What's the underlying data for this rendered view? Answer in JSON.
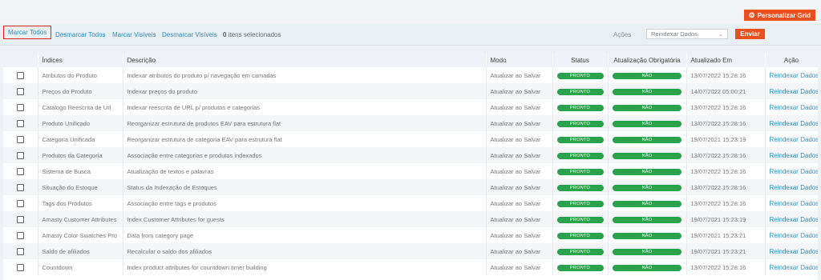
{
  "header": {
    "customize_grid_label": "Personalizar Grid"
  },
  "massaction": {
    "select_all": "Marcar Todos",
    "unselect_all": "Desmarcar Todos",
    "select_visible": "Marcar Visíveis",
    "unselect_visible": "Desmarcar Visíveis",
    "selected_count": "0",
    "selected_suffix": "itens selecionados",
    "actions_label": "Ações",
    "actions_value": "Reindexar Dados",
    "submit_label": "Enviar"
  },
  "table": {
    "columns": [
      "Índices",
      "Descrição",
      "Modo",
      "Status",
      "Atualização Obrigatória",
      "Atualizado Em",
      "Ação"
    ],
    "rows": [
      {
        "index": "Atributos do Produto",
        "description": "Indexar atributos do produto p/ navegação em camadas",
        "mode": "Atualizar ao Salvar",
        "status": "PRONTO",
        "required": "NÃO",
        "updated": "13/07/2022 15:28:16",
        "action": "Reindexar Dados"
      },
      {
        "index": "Preços do Produto",
        "description": "Indexar preços do produto",
        "mode": "Atualizar ao Salvar",
        "status": "PRONTO",
        "required": "NÃO",
        "updated": "14/07/2022 05:00:21",
        "action": "Reindexar Dados"
      },
      {
        "index": "Catálogo Reescrita de Url",
        "description": "Indexar reescrita de URL p/ produtos e categorias",
        "mode": "Atualizar ao Salvar",
        "status": "PRONTO",
        "required": "NÃO",
        "updated": "13/07/2022 15:28:16",
        "action": "Reindexar Dados"
      },
      {
        "index": "Produto Unificado",
        "description": "Reorganizar estrutura de produtos EAV para estrutura flat",
        "mode": "Atualizar ao Salvar",
        "status": "PRONTO",
        "required": "NÃO",
        "updated": "13/07/2022 15:28:16",
        "action": "Reindexar Dados"
      },
      {
        "index": "Categoria Unificada",
        "description": "Reorganizar estrutura de categoria EAV para estrutura flat",
        "mode": "Atualizar ao Salvar",
        "status": "PRONTO",
        "required": "NÃO",
        "updated": "19/07/2021 15:23:19",
        "action": "Reindexar Dados"
      },
      {
        "index": "Produtos da Categoria",
        "description": "Associação entre categorias e produtos indexados",
        "mode": "Atualizar ao Salvar",
        "status": "PRONTO",
        "required": "NÃO",
        "updated": "13/07/2022 15:28:16",
        "action": "Reindexar Dados"
      },
      {
        "index": "Sistema de Busca",
        "description": "Atualização de textos e palavras",
        "mode": "Atualizar ao Salvar",
        "status": "PRONTO",
        "required": "NÃO",
        "updated": "13/07/2022 15:28:16",
        "action": "Reindexar Dados"
      },
      {
        "index": "Situação do Estoque",
        "description": "Status da Indexação de Estoques",
        "mode": "Atualizar ao Salvar",
        "status": "PRONTO",
        "required": "NÃO",
        "updated": "13/07/2022 15:28:16",
        "action": "Reindexar Dados"
      },
      {
        "index": "Tags dos Produtos",
        "description": "Associação entre tags e produtos",
        "mode": "Atualizar ao Salvar",
        "status": "PRONTO",
        "required": "NÃO",
        "updated": "13/07/2022 15:28:16",
        "action": "Reindexar Dados"
      },
      {
        "index": "Amasty Customer Attributes",
        "description": "Index Customer Attributes for guests",
        "mode": "Atualizar ao Salvar",
        "status": "PRONTO",
        "required": "NÃO",
        "updated": "19/07/2021 15:23:19",
        "action": "Reindexar Dados"
      },
      {
        "index": "Amasty Color Swatches Pro",
        "description": "Data from category page",
        "mode": "Atualizar ao Salvar",
        "status": "PRONTO",
        "required": "NÃO",
        "updated": "19/07/2021 15:23:21",
        "action": "Reindexar Dados"
      },
      {
        "index": "Saldo de afiliados",
        "description": "Recalcular o saldo dos afiliados",
        "mode": "Atualizar ao Salvar",
        "status": "PRONTO",
        "required": "NÃO",
        "updated": "19/07/2021 15:23:21",
        "action": "Reindexar Dados"
      },
      {
        "index": "Countdown",
        "description": "Index product attributes for countdown timer building",
        "mode": "Atualizar ao Salvar",
        "status": "PRONTO",
        "required": "NÃO",
        "updated": "13/07/2022 15:28:16",
        "action": "Reindexar Dados"
      }
    ]
  },
  "colors": {
    "accent": "#e8501f",
    "link": "#2b8fd0",
    "badge": "#2aa14b",
    "highlight": "#e02020"
  },
  "icons": {
    "customize_grid": "gear-icon",
    "select": "chevron-down-icon"
  }
}
